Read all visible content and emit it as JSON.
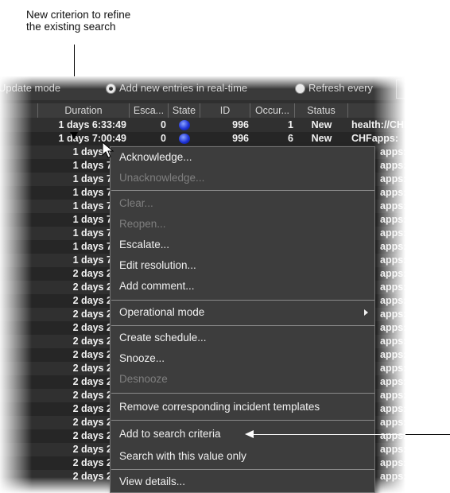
{
  "callout": {
    "top_text_line1": "New criterion to refine",
    "top_text_line2": "the existing search"
  },
  "toolbar": {
    "update_mode_label": "Update mode",
    "add_realtime_label": "Add new entries in real-time",
    "refresh_label": "Refresh every"
  },
  "table": {
    "headers": [
      "Duration",
      "Esca...",
      "State",
      "ID",
      "Occur...",
      "Status"
    ],
    "rows": [
      {
        "duration": "1 days 6:33:49",
        "esca": "0",
        "id": "996",
        "occur": "1",
        "status": "New",
        "extra": "health://CHF"
      },
      {
        "duration": "1 days 7:00:49",
        "esca": "0",
        "id": "996",
        "occur": "6",
        "status": "New",
        "extra": "CHFapps:"
      },
      {
        "duration": "1 days 7:00",
        "extra": "apps:"
      },
      {
        "duration": "1 days 7:00",
        "extra": "apps:"
      },
      {
        "duration": "1 days 7:00",
        "extra": "apps:"
      },
      {
        "duration": "1 days 7:00",
        "extra": "apps:"
      },
      {
        "duration": "1 days 7:00",
        "extra": "apps:"
      },
      {
        "duration": "1 days 7:00",
        "extra": "apps:"
      },
      {
        "duration": "1 days 7:00",
        "extra": "apps:"
      },
      {
        "duration": "1 days 7:00",
        "extra": "apps:"
      },
      {
        "duration": "1 days 7:00",
        "extra": "apps:"
      },
      {
        "duration": "2 days 2:48",
        "extra": "apps:"
      },
      {
        "duration": "2 days 2:48",
        "extra": "apps:"
      },
      {
        "duration": "2 days 2:48",
        "extra": "apps:"
      },
      {
        "duration": "2 days 2:48",
        "extra": "apps:"
      },
      {
        "duration": "2 days 2:48",
        "extra": "apps:"
      },
      {
        "duration": "2 days 2:48",
        "extra": "apps:"
      },
      {
        "duration": "2 days 2:48",
        "extra": "apps:"
      },
      {
        "duration": "2 days 2:48",
        "extra": "apps:"
      },
      {
        "duration": "2 days 2:48",
        "extra": "apps:"
      },
      {
        "duration": "2 days 2:48",
        "extra": "apps:"
      },
      {
        "duration": "2 days 2:48",
        "extra": "apps:"
      },
      {
        "duration": "2 days 2:48",
        "extra": "apps:"
      },
      {
        "duration": "2 days 2:48",
        "extra": "apps:"
      },
      {
        "duration": "2 days 2:48",
        "extra": "apps:"
      },
      {
        "duration": "2 days 2:48",
        "extra": "apps:"
      },
      {
        "duration": "2 days 2:48",
        "extra": "apps:"
      }
    ]
  },
  "menu": {
    "acknowledge": "Acknowledge...",
    "unacknowledge": "Unacknowledge...",
    "clear": "Clear...",
    "reopen": "Reopen...",
    "escalate": "Escalate...",
    "edit_resolution": "Edit resolution...",
    "add_comment": "Add comment...",
    "operational_mode": "Operational mode",
    "create_schedule": "Create schedule...",
    "snooze": "Snooze...",
    "desnooze": "Desnooze",
    "remove_templates": "Remove corresponding incident templates",
    "add_to_search": "Add to search criteria",
    "search_only": "Search with this value only",
    "view_details": "View details..."
  },
  "colors": {
    "state_dot": "#1f34d8",
    "background": "#2f2f2f"
  }
}
